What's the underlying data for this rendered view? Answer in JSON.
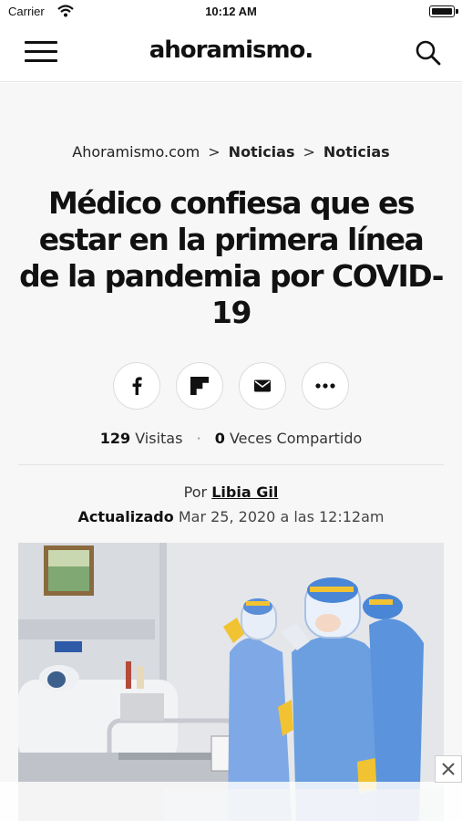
{
  "status_bar": {
    "carrier": "Carrier",
    "time": "10:12 AM"
  },
  "header": {
    "logo": "ahoramismo.",
    "menu_icon": "hamburger-menu-icon",
    "search_icon": "search-icon"
  },
  "breadcrumb": {
    "items": [
      "Ahoramismo.com",
      "Noticias",
      "Noticias"
    ],
    "separator": ">"
  },
  "article": {
    "title": "Médico confiesa que es estar en la primera línea de la pandemia por COVID-19",
    "share_buttons": [
      "facebook-icon",
      "flipboard-icon",
      "email-icon",
      "more-icon"
    ],
    "views_count": "129",
    "views_label": "Visitas",
    "dot": "·",
    "shares_count": "0",
    "shares_label": "Veces Compartido",
    "by_label": "Por",
    "author": "Libia Gil",
    "updated_label": "Actualizado",
    "updated_date": "Mar 25, 2020 a las 12:12am"
  },
  "ad": {
    "close_label": "✕"
  },
  "colors": {
    "text": "#111111",
    "background": "#f7f7f7",
    "ppe_blue": "#6b9fe0"
  }
}
